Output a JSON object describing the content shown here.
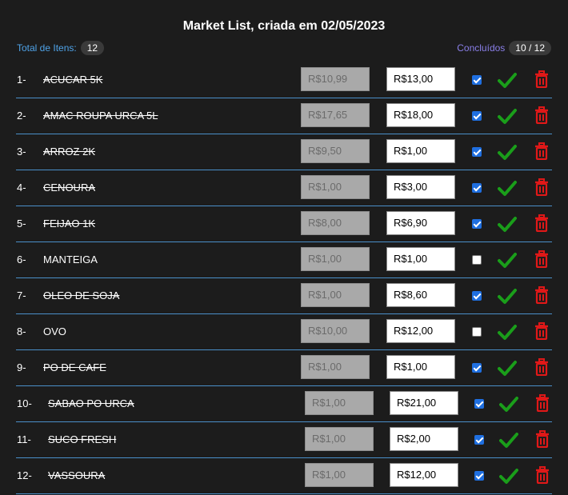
{
  "header": {
    "title": "Market List, criada em 02/05/2023",
    "total_label": "Total de Itens:",
    "total_count": "12",
    "done_label": "Concluídos",
    "done_count": "10 / 12"
  },
  "colors": {
    "accent": "#4fa3e8",
    "done_accent": "#8a7fe8",
    "ok": "#1a9e1a",
    "delete": "#e01818"
  },
  "icons": {
    "confirm": "check-icon",
    "delete": "trash-icon"
  },
  "items": [
    {
      "num": "1-",
      "name": "ACUCAR 5K",
      "estimated": "R$10,99",
      "real": "R$13,00",
      "checked": true
    },
    {
      "num": "2-",
      "name": "AMAC ROUPA URCA 5L",
      "estimated": "R$17,65",
      "real": "R$18,00",
      "checked": true
    },
    {
      "num": "3-",
      "name": "ARROZ 2K",
      "estimated": "R$9,50",
      "real": "R$1,00",
      "checked": true
    },
    {
      "num": "4-",
      "name": "CENOURA",
      "estimated": "R$1,00",
      "real": "R$3,00",
      "checked": true
    },
    {
      "num": "5-",
      "name": "FEIJAO 1K",
      "estimated": "R$8,00",
      "real": "R$6,90",
      "checked": true
    },
    {
      "num": "6-",
      "name": "MANTEIGA",
      "estimated": "R$1,00",
      "real": "R$1,00",
      "checked": false
    },
    {
      "num": "7-",
      "name": "OLEO DE SOJA",
      "estimated": "R$1,00",
      "real": "R$8,60",
      "checked": true
    },
    {
      "num": "8-",
      "name": "OVO",
      "estimated": "R$10,00",
      "real": "R$12,00",
      "checked": false
    },
    {
      "num": "9-",
      "name": "PO DE CAFE",
      "estimated": "R$1,00",
      "real": "R$1,00",
      "checked": true
    },
    {
      "num": "10-",
      "name": "SABAO PO URCA",
      "estimated": "R$1,00",
      "real": "R$21,00",
      "checked": true
    },
    {
      "num": "11-",
      "name": "SUCO FRESH",
      "estimated": "R$1,00",
      "real": "R$2,00",
      "checked": true
    },
    {
      "num": "12-",
      "name": "VASSOURA",
      "estimated": "R$1,00",
      "real": "R$12,00",
      "checked": true
    }
  ]
}
